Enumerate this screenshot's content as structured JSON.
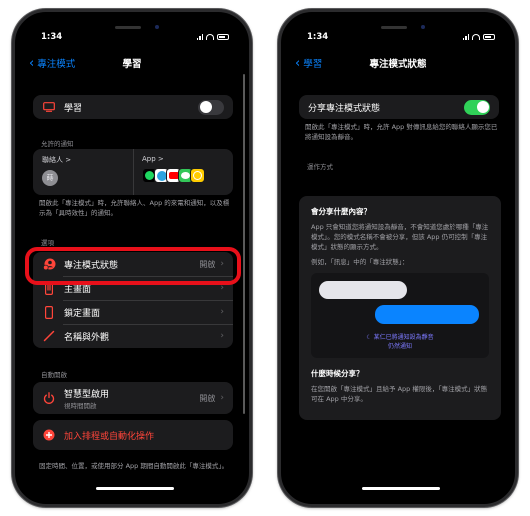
{
  "left_screen": {
    "status_time": "1:34",
    "nav": {
      "back_label": "專注模式",
      "title": "學習"
    },
    "focus_row": {
      "label": "學習",
      "toggle_on": false
    },
    "allowed_section": {
      "header": "允許的通知",
      "people_label": "聯絡人 >",
      "person_avatar": "蒔",
      "apps_label": "App >",
      "apps": [
        "Spotify",
        "Telegram",
        "YouTube",
        "Messages",
        "Clock"
      ],
      "footnote": "開啟此「專注模式」時，允許聯絡人、App 的來電和通知，以及標示為「具時效性」的通知。"
    },
    "options_section": {
      "header": "選項",
      "items": [
        {
          "label": "專注模式狀態",
          "value": "開啟",
          "icon": "focus-status-icon"
        },
        {
          "label": "主畫面",
          "value": "",
          "icon": "home-screen-icon"
        },
        {
          "label": "鎖定畫面",
          "value": "",
          "icon": "lock-screen-icon"
        },
        {
          "label": "名稱與外觀",
          "value": "",
          "icon": "pencil-icon"
        }
      ]
    },
    "auto_section": {
      "header": "自動開啟",
      "smart_label": "智慧型啟用",
      "smart_sub": "視時間開啟",
      "smart_value": "開啟",
      "add_label": "加入排程或自動化操作",
      "footnote": "固定時間、位置，或使用部分 App 期間自動開啟此「專注模式」。"
    }
  },
  "right_screen": {
    "status_time": "1:34",
    "nav": {
      "back_label": "學習",
      "title": "專注模式狀態"
    },
    "share_row": {
      "label": "分享專注模式狀態",
      "toggle_on": true
    },
    "share_footnote": "開啟此「專注模式」時，允許 App 對傳訊息給您的聯絡人顯示您已將通知設為靜音。",
    "how_label": "運作方式",
    "card": {
      "q1": "會分享什麼內容？",
      "a1": "App 只會知道您將通知設為靜音，不會知道您處於哪種「專注模式」。您的模式名稱不會被分享，但該 App 仍可控制「專注模式」狀態的顯示方式。",
      "example": "例如，「訊息」中的「專注狀態」：",
      "silenced_line1": "某仁已將通知設為靜音",
      "silenced_line2": "仍然通知",
      "q2": "什麼時候分享？",
      "a2": "在您開啟「專注模式」且給予 App 權限後，「專注模式」狀態可在 App 中分享。"
    }
  },
  "colors": {
    "accent_blue": "#0a84ff",
    "toggle_green": "#30d158",
    "highlight_red": "#e8101a",
    "icon_red": "#ff453a",
    "silenced_purple": "#7d7aff"
  }
}
